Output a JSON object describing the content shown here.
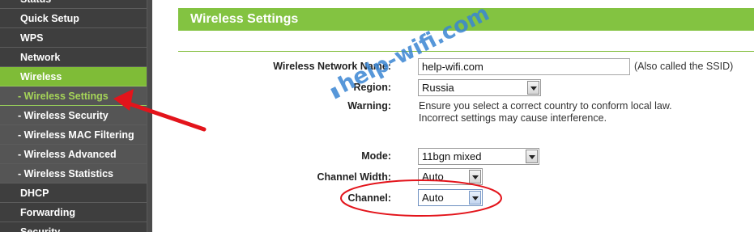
{
  "sidebar": {
    "items": [
      {
        "label": "Status",
        "type": "main",
        "active": false
      },
      {
        "label": "Quick Setup",
        "type": "main",
        "active": false
      },
      {
        "label": "WPS",
        "type": "main",
        "active": false
      },
      {
        "label": "Network",
        "type": "main",
        "active": false
      },
      {
        "label": "Wireless",
        "type": "main",
        "active": true
      },
      {
        "label": "- Wireless Settings",
        "type": "sub",
        "active": true
      },
      {
        "label": "- Wireless Security",
        "type": "sub",
        "active": false
      },
      {
        "label": "- Wireless MAC Filtering",
        "type": "sub",
        "active": false
      },
      {
        "label": "- Wireless Advanced",
        "type": "sub",
        "active": false
      },
      {
        "label": "- Wireless Statistics",
        "type": "sub",
        "active": false
      },
      {
        "label": "DHCP",
        "type": "main",
        "active": false
      },
      {
        "label": "Forwarding",
        "type": "main",
        "active": false
      },
      {
        "label": "Security",
        "type": "main",
        "active": false
      }
    ]
  },
  "page": {
    "title": "Wireless Settings"
  },
  "form": {
    "network_name_label": "Wireless Network Name:",
    "network_name_value": "help-wifi.com",
    "network_name_note": "(Also called the SSID)",
    "region_label": "Region:",
    "region_value": "Russia",
    "warning_label": "Warning:",
    "warning_line1": "Ensure you select a correct country to conform local law.",
    "warning_line2": "Incorrect settings may cause interference.",
    "mode_label": "Mode:",
    "mode_value": "11bgn mixed",
    "channel_width_label": "Channel Width:",
    "channel_width_value": "Auto",
    "channel_label": "Channel:",
    "channel_value": "Auto"
  },
  "watermark": {
    "text": "help-wifi.com"
  },
  "colors": {
    "accent_green": "#83c341",
    "active_sub_text": "#a6d558",
    "annotation_red": "#e3141b",
    "watermark_blue": "#3a86d3"
  }
}
